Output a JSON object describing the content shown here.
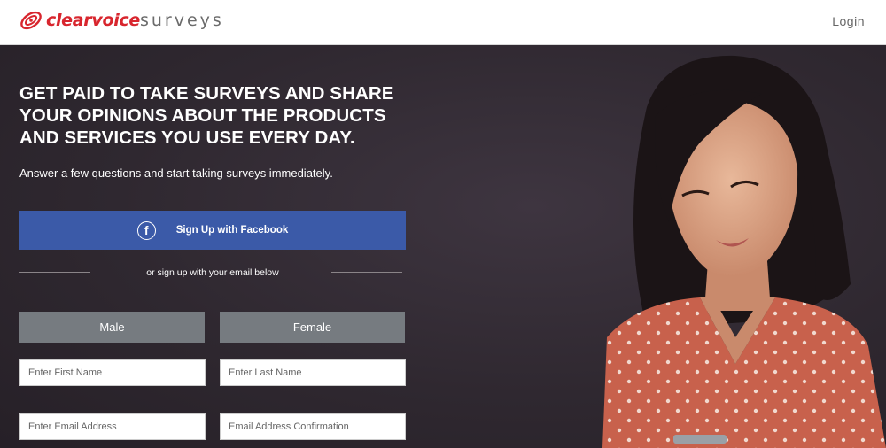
{
  "header": {
    "brand_name": "clearvoice",
    "brand_suffix": "surveys",
    "login_label": "Login"
  },
  "hero": {
    "headline": "GET PAID TO TAKE SURVEYS AND SHARE YOUR OPINIONS ABOUT THE PRODUCTS AND SERVICES YOU USE EVERY DAY.",
    "subhead": "Answer a few questions and start taking surveys immediately."
  },
  "signup": {
    "facebook_icon": "f",
    "facebook_label": "Sign Up with Facebook",
    "email_divider_text": "or sign up with your email below",
    "male_label": "Male",
    "female_label": "Female",
    "first_name_placeholder": "Enter First Name",
    "last_name_placeholder": "Enter Last Name",
    "email_placeholder": "Enter Email Address",
    "email_confirm_placeholder": "Email Address Confirmation"
  },
  "colors": {
    "brand_red": "#d8262e",
    "facebook_blue": "#3b5aa8",
    "gender_gray": "#767b80",
    "hero_bg": "#2e2830"
  }
}
